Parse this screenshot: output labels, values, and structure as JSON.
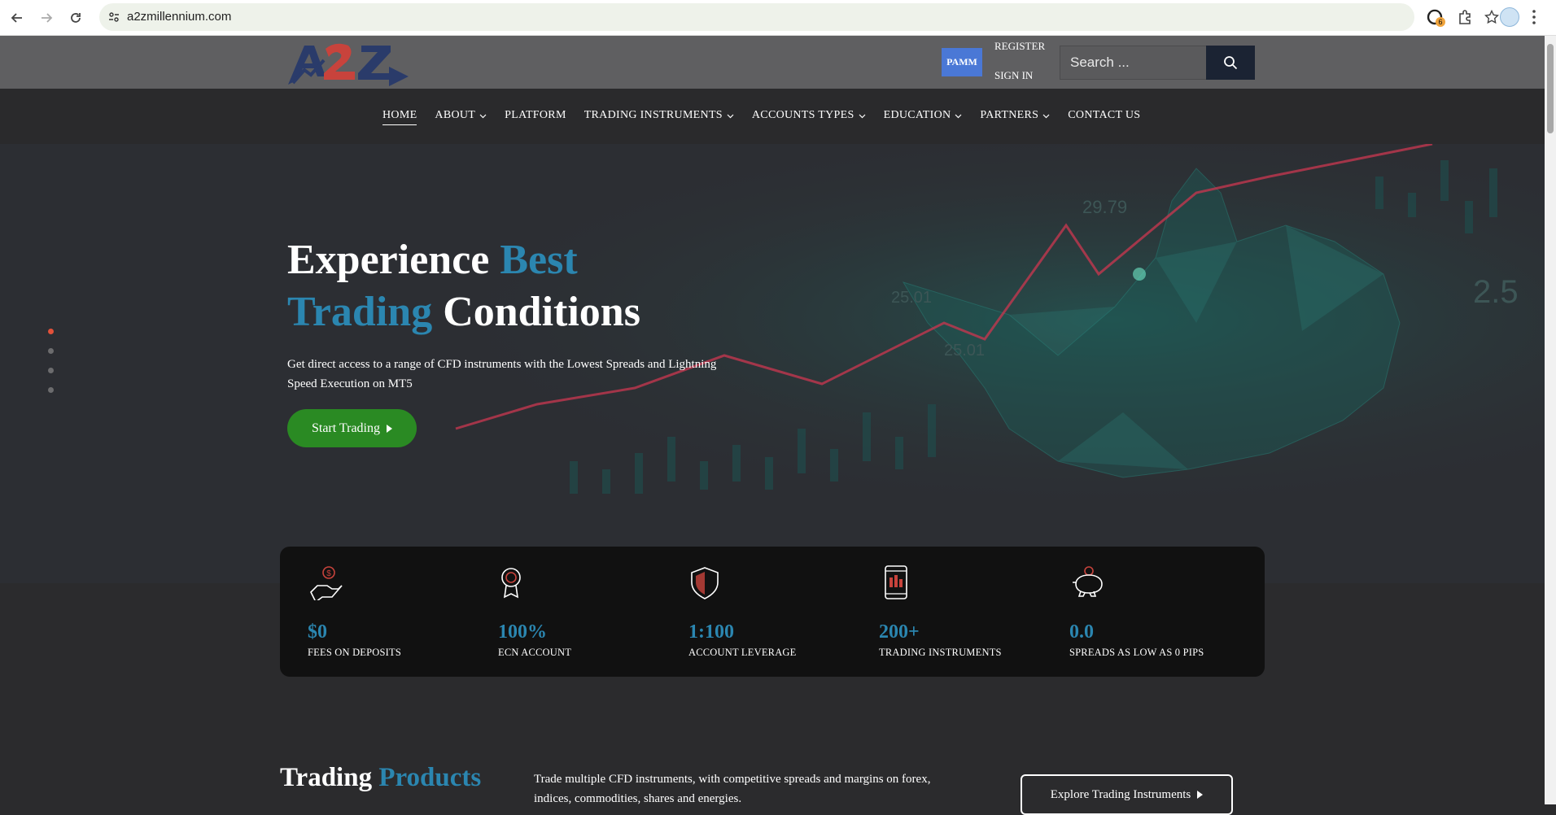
{
  "browser": {
    "url": "a2zmillennium.com",
    "extension_badge": "6"
  },
  "topbar": {
    "pamm_label": "PAMM",
    "register_label": "REGISTER",
    "signin_label": "SIGN IN",
    "search_placeholder": "Search ..."
  },
  "nav": {
    "items": [
      {
        "label": "HOME",
        "active": true,
        "dropdown": false
      },
      {
        "label": "ABOUT",
        "active": false,
        "dropdown": true
      },
      {
        "label": "PLATFORM",
        "active": false,
        "dropdown": false
      },
      {
        "label": "TRADING INSTRUMENTS",
        "active": false,
        "dropdown": true
      },
      {
        "label": "ACCOUNTS TYPES",
        "active": false,
        "dropdown": true
      },
      {
        "label": "EDUCATION",
        "active": false,
        "dropdown": true
      },
      {
        "label": "PARTNERS",
        "active": false,
        "dropdown": true
      },
      {
        "label": "CONTACT US",
        "active": false,
        "dropdown": false
      }
    ]
  },
  "hero": {
    "title_part1": "Experience ",
    "title_accent1": "Best",
    "title_accent2": "Trading",
    "title_part2": " Conditions",
    "subtitle": "Get direct access to a range of CFD instruments with the Lowest Spreads and Lightning Speed Execution on MT5",
    "cta_label": "Start Trading",
    "bg_labels": [
      "29.79",
      "25.01",
      "25.01",
      "2.5"
    ]
  },
  "stats": [
    {
      "icon": "hand-dollar-icon",
      "value": "$0",
      "label": "FEES ON DEPOSITS"
    },
    {
      "icon": "award-medal-icon",
      "value": "100%",
      "label": "ECN ACCOUNT"
    },
    {
      "icon": "shield-icon",
      "value": "1:100",
      "label": "ACCOUNT LEVERAGE"
    },
    {
      "icon": "mobile-chart-icon",
      "value": "200+",
      "label": "TRADING INSTRUMENTS"
    },
    {
      "icon": "piggy-bank-icon",
      "value": "0.0",
      "label": "SPREADS AS LOW AS 0 PIPS"
    }
  ],
  "products": {
    "title_part1": "Trading ",
    "title_accent": "Products",
    "text": "Trade multiple CFD instruments, with competitive spreads and margins on forex, indices, commodities, shares and energies.",
    "cta_label": "Explore Trading Instruments"
  },
  "colors": {
    "accent_blue": "#2b86b0",
    "cta_green": "#2a8a23",
    "pamm_blue": "#4a78d6",
    "active_dot": "#e2513a"
  }
}
